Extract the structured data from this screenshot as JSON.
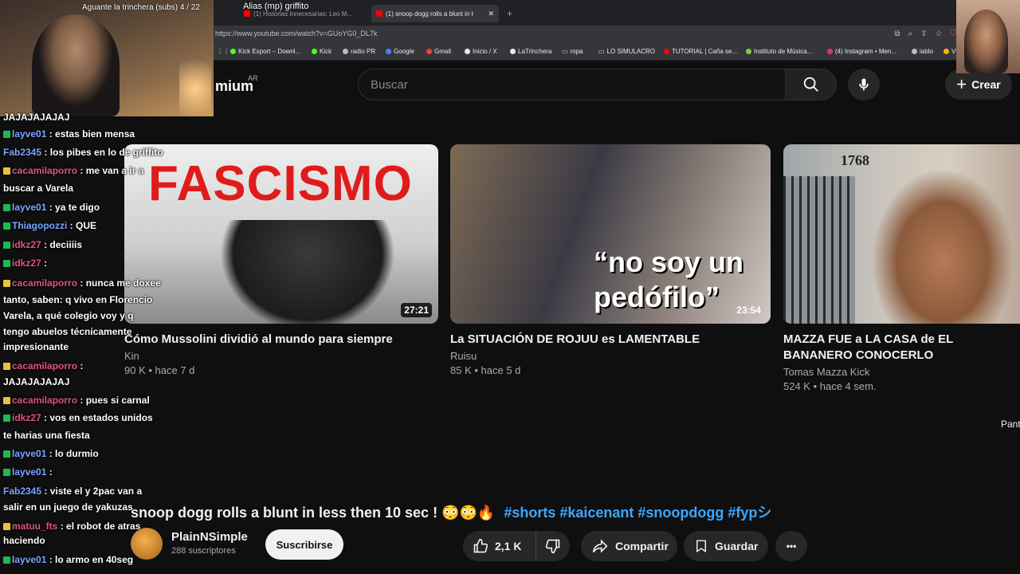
{
  "browser": {
    "tabs": [
      "(1) Historias Innecesarias: Leo M...",
      "(1) snoop dogg rolls a blunt in le..."
    ],
    "new_tab_label": "+",
    "url": "https://www.youtube.com/watch?v=GUoYG0_DL7k",
    "bookmarks": [
      "Kick Export – Downl...",
      "Kick",
      "radio PR",
      "Google",
      "Gmail",
      "Inicio / X",
      "LaTrinchera",
      "ropa",
      "LO SIMULACRO",
      "TUTORIAL | Caña se...",
      "Instituto de Música...",
      "(4) Instagram • Men...",
      "iablo",
      "VO"
    ],
    "colors": {
      "tabstrip": "#202124",
      "toolbar": "#35363a"
    }
  },
  "youtube": {
    "logo_text": "mium",
    "region": "AR",
    "search": {
      "placeholder": "Buscar"
    },
    "create_label": "Crear",
    "icons": [
      "search-icon",
      "mic-icon",
      "plus-icon"
    ],
    "videos": [
      {
        "thumb_text": "FASCISMO",
        "duration": "27:21",
        "title": "Cómo Mussolini dividió al mundo para siempre",
        "channel": "Kin",
        "meta": "90 K • hace 7 d"
      },
      {
        "thumb_text": "“no soy un pedófilo”",
        "duration": "23:54",
        "title": "La SITUACIÓN DE ROJUU es LAMENTABLE",
        "channel": "Ruisu",
        "meta": "85 K • hace 5 d"
      },
      {
        "thumb_text": "1768",
        "duration": "",
        "title": "MAZZA FUE a LA CASA de EL BANANERO CONOCERLO",
        "channel": "Tomas Mazza Kick",
        "meta": "524 K • hace 4 sem."
      }
    ],
    "side_label": "Pant",
    "current": {
      "title": "snoop dogg rolls a blunt in less then 10 sec ! 😳😳🔥",
      "hashtags": "#shorts #kaicenant #snoopdogg #fypシ",
      "channel": "PlainNSimple",
      "subscribers": "288 suscriptores",
      "subscribe_label": "Suscribirse",
      "likes": "2,1 K",
      "share_label": "Compartir",
      "save_label": "Guardar",
      "more_label": "•••"
    },
    "accent": "#3ea6ff"
  },
  "stream": {
    "cam_title": "Aguante la trinchera (subs) 4 / 22",
    "alias": "Alias (mp) griffito",
    "chat": [
      {
        "user": "",
        "text": "JAJAJAJAJAJ",
        "badge": ""
      },
      {
        "user": "layve01",
        "text": ": estas bien mensa",
        "badge": "g"
      },
      {
        "user": "Fab2345",
        "text": ": los pibes en lo de griffito",
        "badge": ""
      },
      {
        "user": "cacamilaporro",
        "text": ": me van a ir a",
        "badge": "y"
      },
      {
        "user": "",
        "text": "buscar a Varela",
        "badge": ""
      },
      {
        "user": "layve01",
        "text": ": ya te digo",
        "badge": "g"
      },
      {
        "user": "Thiagopozzi",
        "text": ": QUE",
        "badge": "g"
      },
      {
        "user": "idkz27",
        "text": ": deciiiis",
        "badge": "g"
      },
      {
        "user": "idkz27",
        "text": ":",
        "badge": "g"
      },
      {
        "user": "cacamilaporro",
        "text": ": nunca me doxee",
        "badge": "y"
      },
      {
        "user": "",
        "text": "tanto, saben: q vivo en Florencio",
        "badge": ""
      },
      {
        "user": "",
        "text": "Varela, a qué colegio voy y q",
        "badge": ""
      },
      {
        "user": "",
        "text": "tengo abuelos técnicamente",
        "badge": ""
      },
      {
        "user": "",
        "text": "impresionante",
        "badge": ""
      },
      {
        "user": "cacamilaporro",
        "text": ":",
        "badge": "y"
      },
      {
        "user": "",
        "text": "JAJAJAJAJAJ",
        "badge": ""
      },
      {
        "user": "cacamilaporro",
        "text": ": pues si carnal",
        "badge": "y"
      },
      {
        "user": "idkz27",
        "text": ": vos en estados unidos",
        "badge": "g"
      },
      {
        "user": "",
        "text": "te harias una fiesta",
        "badge": ""
      },
      {
        "user": "layve01",
        "text": ": lo durmio",
        "badge": "g"
      },
      {
        "user": "layve01",
        "text": ":",
        "badge": "g"
      },
      {
        "user": "Fab2345",
        "text": ": viste    el y 2pac van a",
        "badge": ""
      },
      {
        "user": "",
        "text": "salir en un juego de yakuzas",
        "badge": ""
      },
      {
        "user": "matuu_fts",
        "text": ": el robot de atras",
        "badge": "y"
      },
      {
        "user": "",
        "text": "haciendo",
        "badge": ""
      },
      {
        "user": "layve01",
        "text": ": lo armo en 40seg",
        "badge": "g"
      }
    ]
  }
}
